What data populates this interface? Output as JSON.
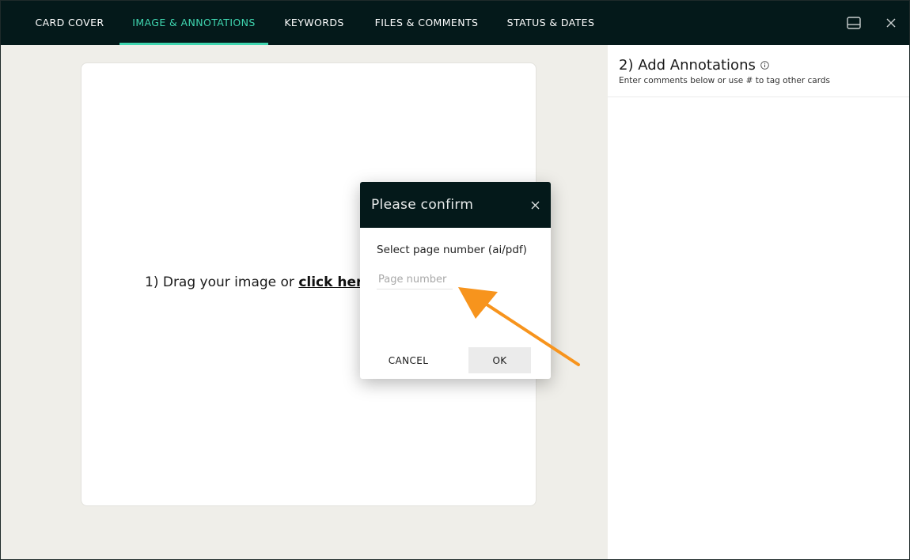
{
  "tabs": [
    {
      "label": "CARD COVER",
      "active": false
    },
    {
      "label": "IMAGE & ANNOTATIONS",
      "active": true
    },
    {
      "label": "KEYWORDS",
      "active": false
    },
    {
      "label": "FILES & COMMENTS",
      "active": false
    },
    {
      "label": "STATUS & DATES",
      "active": false
    }
  ],
  "topbar_icons": [
    "layout-panel-icon",
    "close-icon"
  ],
  "dropzone": {
    "prefix": "1) Drag your image or ",
    "link": "click here"
  },
  "annotations": {
    "title": "2) Add Annotations",
    "info_icon": "info-icon",
    "subtitle": "Enter comments below or use # to tag other cards"
  },
  "modal": {
    "title": "Please confirm",
    "label": "Select page number (ai/pdf)",
    "input_placeholder": "Page number",
    "input_value": "",
    "cancel_label": "CANCEL",
    "ok_label": "OK"
  },
  "colors": {
    "topbar": "#04191a",
    "accent": "#3fd6b0",
    "arrow": "#f7941d",
    "left_pane_bg": "#efeee9"
  }
}
